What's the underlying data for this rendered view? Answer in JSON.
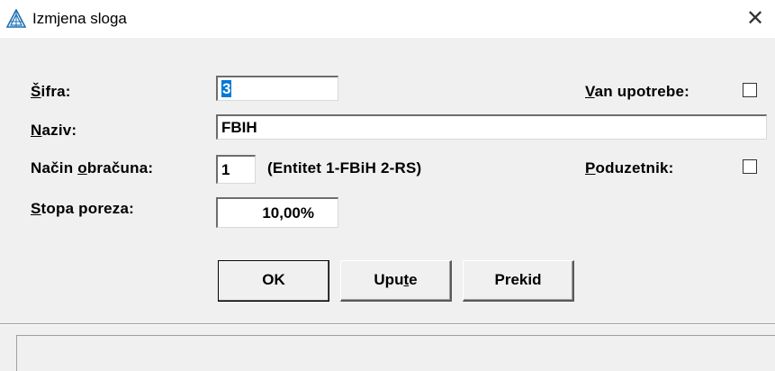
{
  "window": {
    "title": "Izmjena sloga",
    "close_glyph": "✕",
    "icon": "app-triangle-icon",
    "icon_color": "#1f6fb5"
  },
  "form": {
    "sifra": {
      "label_mnemonic": "Š",
      "label_rest": "ifra:",
      "value": "3"
    },
    "naziv": {
      "label_mnemonic": "N",
      "label_rest": "aziv:",
      "value": "FBIH"
    },
    "nacin_obracuna": {
      "label_pre": "Način ",
      "label_mnemonic": "o",
      "label_rest": "bračuna:",
      "value": "1",
      "hint": "(Entitet 1-FBiH 2-RS)"
    },
    "stopa_poreza": {
      "label_mnemonic": "S",
      "label_rest": "topa poreza:",
      "value": "10,00%"
    },
    "van_upotrebe": {
      "label_mnemonic": "V",
      "label_rest": "an upotrebe:",
      "checked": false
    },
    "poduzetnik": {
      "label_mnemonic": "P",
      "label_rest": "oduzetnik:",
      "checked": false
    }
  },
  "buttons": {
    "ok": "OK",
    "upute_pre": "Upu",
    "upute_mnemonic": "t",
    "upute_rest": "e",
    "prekid": "Prekid"
  },
  "status": {
    "text": ""
  }
}
